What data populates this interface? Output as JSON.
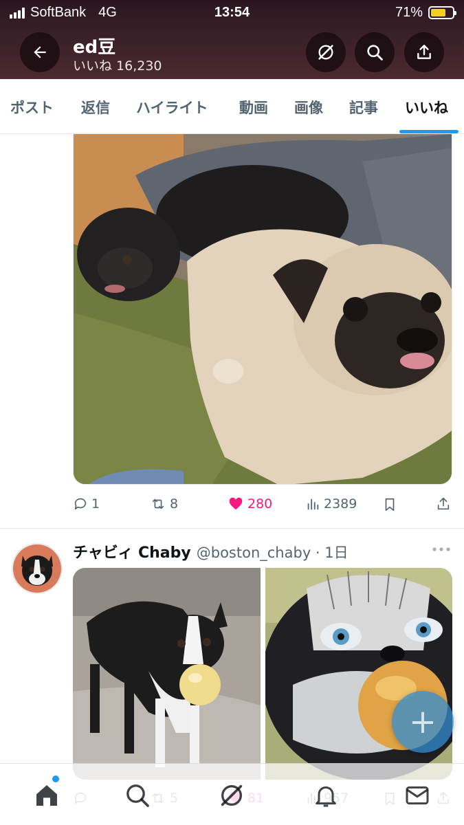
{
  "status_bar": {
    "carrier": "SoftBank",
    "network": "4G",
    "time": "13:54",
    "battery_percent": "71%",
    "battery_level": 0.71
  },
  "header": {
    "profile_name": "ed豆",
    "likes_label": "いいね 16,230",
    "icons": [
      "back-arrow-icon",
      "grok-icon",
      "search-icon",
      "share-icon"
    ]
  },
  "tabs": [
    {
      "label": "ポスト"
    },
    {
      "label": "返信"
    },
    {
      "label": "ハイライト"
    },
    {
      "label": "動画"
    },
    {
      "label": "画像"
    },
    {
      "label": "記事"
    },
    {
      "label": "いいね",
      "active": true
    }
  ],
  "post1": {
    "image": "photo-two-pugs",
    "reply_count": "1",
    "repost_count": "8",
    "like_count": "280",
    "view_count": "2389",
    "liked": true
  },
  "post2": {
    "display_name": "チャビィ Chaby",
    "meta": "@boston_chaby · 1日",
    "images": [
      "photo-boston-terrier-with-ball",
      "illustration-anime-dog-with-ball"
    ]
  },
  "bottom_overlay": {
    "reply_count": "",
    "repost_count": "5",
    "like_count": "81",
    "view_count": "957"
  },
  "nav": [
    "home-icon",
    "search-icon",
    "grok-icon",
    "notifications-icon",
    "messages-icon"
  ],
  "colors": {
    "accent": "#1d9bf0",
    "like": "#f91880",
    "text_secondary": "#536471",
    "header_bg": "#3a2028"
  }
}
